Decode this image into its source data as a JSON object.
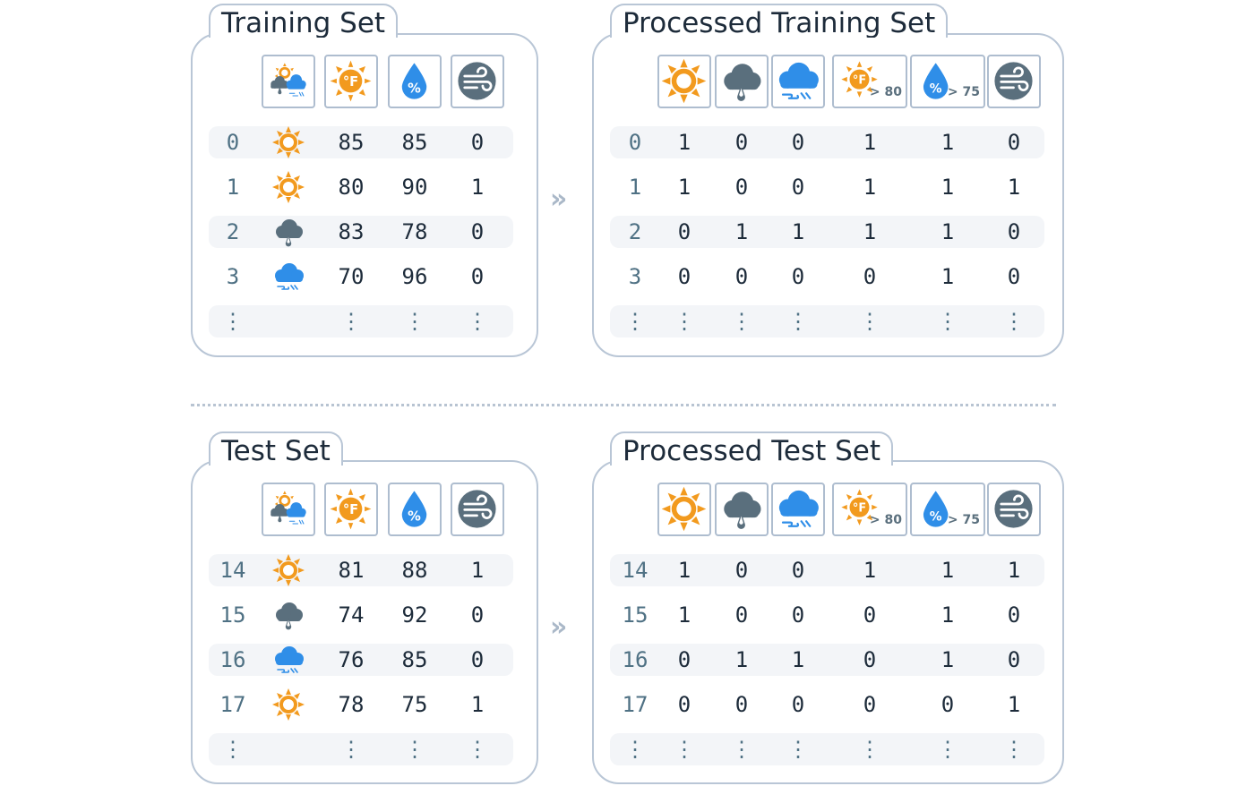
{
  "colors": {
    "sun": "#f29a1e",
    "rain": "#5a6f7d",
    "snow": "#2f8ee8",
    "humidity": "#2f8ee8",
    "wind": "#5a6f7d",
    "border": "#b9c6d6"
  },
  "raw_headers": [
    {
      "icon": "weather-outlook-icon"
    },
    {
      "icon": "temperature-icon"
    },
    {
      "icon": "humidity-icon"
    },
    {
      "icon": "wind-icon"
    }
  ],
  "proc_headers": [
    {
      "icon": "sunny-icon"
    },
    {
      "icon": "rainy-icon"
    },
    {
      "icon": "snowy-icon"
    },
    {
      "icon": "temperature-above-icon",
      "label": "> 80"
    },
    {
      "icon": "humidity-above-icon",
      "label": "> 75"
    },
    {
      "icon": "wind-icon"
    }
  ],
  "ellipsis": "⋮",
  "training": {
    "title": "Training Set",
    "rows": [
      {
        "index": "0",
        "outlook": "sunny",
        "temp": "85",
        "humidity": "85",
        "wind": "0"
      },
      {
        "index": "1",
        "outlook": "sunny",
        "temp": "80",
        "humidity": "90",
        "wind": "1"
      },
      {
        "index": "2",
        "outlook": "rainy",
        "temp": "83",
        "humidity": "78",
        "wind": "0"
      },
      {
        "index": "3",
        "outlook": "snowy",
        "temp": "70",
        "humidity": "96",
        "wind": "0"
      }
    ]
  },
  "processed_training": {
    "title": "Processed Training Set",
    "rows": [
      {
        "index": "0",
        "values": [
          "1",
          "0",
          "0",
          "1",
          "1",
          "0"
        ]
      },
      {
        "index": "1",
        "values": [
          "1",
          "0",
          "0",
          "1",
          "1",
          "1"
        ]
      },
      {
        "index": "2",
        "values": [
          "0",
          "1",
          "1",
          "1",
          "1",
          "0"
        ]
      },
      {
        "index": "3",
        "values": [
          "0",
          "0",
          "0",
          "0",
          "1",
          "0"
        ]
      }
    ]
  },
  "test": {
    "title": "Test Set",
    "rows": [
      {
        "index": "14",
        "outlook": "sunny",
        "temp": "81",
        "humidity": "88",
        "wind": "1"
      },
      {
        "index": "15",
        "outlook": "rainy",
        "temp": "74",
        "humidity": "92",
        "wind": "0"
      },
      {
        "index": "16",
        "outlook": "snowy",
        "temp": "76",
        "humidity": "85",
        "wind": "0"
      },
      {
        "index": "17",
        "outlook": "sunny",
        "temp": "78",
        "humidity": "75",
        "wind": "1"
      }
    ]
  },
  "processed_test": {
    "title": "Processed Test Set",
    "rows": [
      {
        "index": "14",
        "values": [
          "1",
          "0",
          "0",
          "1",
          "1",
          "1"
        ]
      },
      {
        "index": "15",
        "values": [
          "1",
          "0",
          "0",
          "0",
          "1",
          "0"
        ]
      },
      {
        "index": "16",
        "values": [
          "0",
          "1",
          "1",
          "0",
          "1",
          "0"
        ]
      },
      {
        "index": "17",
        "values": [
          "0",
          "0",
          "0",
          "0",
          "0",
          "1"
        ]
      }
    ]
  }
}
